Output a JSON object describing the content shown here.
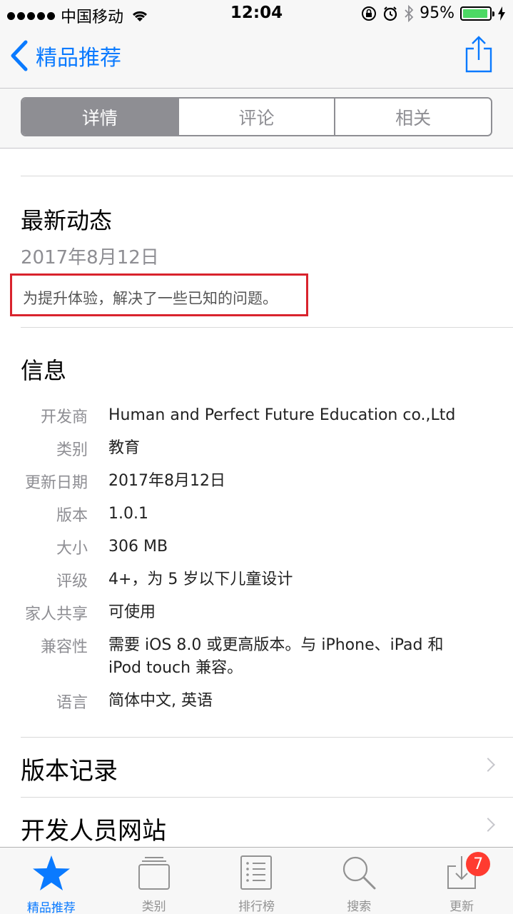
{
  "status_bar": {
    "carrier": "中国移动",
    "time": "12:04",
    "battery": "95%",
    "battery_level": 0.95
  },
  "nav": {
    "back_label": "精品推荐",
    "share_icon": "share-icon"
  },
  "segments": [
    {
      "label": "详情",
      "active": true
    },
    {
      "label": "评论",
      "active": false
    },
    {
      "label": "相关",
      "active": false
    }
  ],
  "whats_new": {
    "title": "最新动态",
    "date": "2017年8月12日",
    "note": "为提升体验，解决了一些已知的问题。"
  },
  "info": {
    "title": "信息",
    "rows": [
      {
        "label": "开发商",
        "value": "Human and Perfect Future Education co.,Ltd"
      },
      {
        "label": "类别",
        "value": "教育"
      },
      {
        "label": "更新日期",
        "value": "2017年8月12日"
      },
      {
        "label": "版本",
        "value": "1.0.1"
      },
      {
        "label": "大小",
        "value": "306 MB"
      },
      {
        "label": "评级",
        "value": "4+，为 5 岁以下儿童设计"
      },
      {
        "label": "家人共享",
        "value": "可使用"
      },
      {
        "label": "兼容性",
        "value": "需要 iOS 8.0 或更高版本。与 iPhone、iPad 和 iPod touch 兼容。"
      },
      {
        "label": "语言",
        "value": "简体中文, 英语"
      }
    ]
  },
  "links": [
    {
      "label": "版本记录"
    },
    {
      "label": "开发人员网站"
    }
  ],
  "tabbar": [
    {
      "label": "精品推荐",
      "icon": "star-icon",
      "active": true
    },
    {
      "label": "类别",
      "icon": "categories-icon",
      "active": false
    },
    {
      "label": "排行榜",
      "icon": "ranking-list-icon",
      "active": false
    },
    {
      "label": "搜索",
      "icon": "search-icon",
      "active": false
    },
    {
      "label": "更新",
      "icon": "updates-icon",
      "active": false,
      "badge": "7"
    }
  ],
  "colors": {
    "accent": "#0a7aff",
    "highlight_box": "#d9232d",
    "badge": "#ff3b30"
  }
}
